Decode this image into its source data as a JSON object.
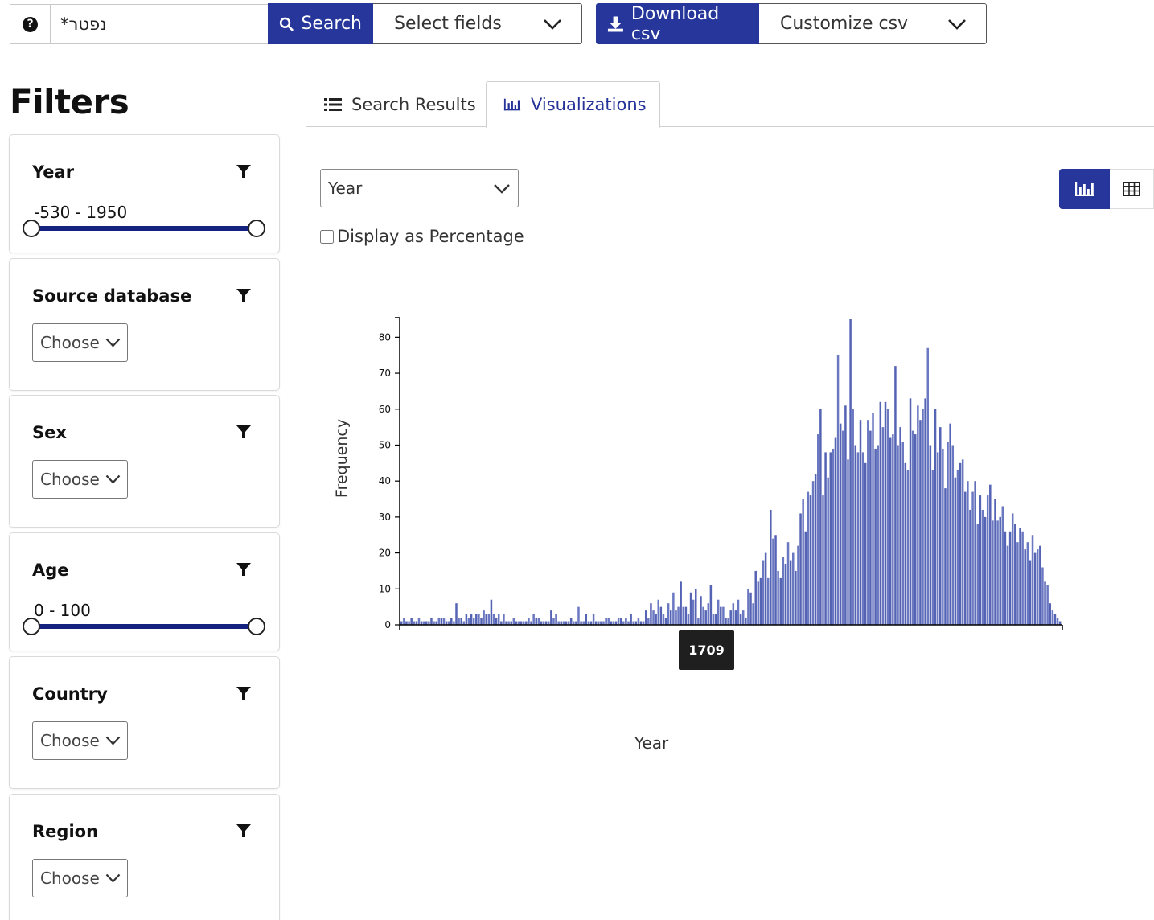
{
  "topbar": {
    "search_value": "נפטר*",
    "search_label": "Search",
    "select_fields_label": "Select fields",
    "download_label": "Download csv",
    "customize_label": "Customize csv"
  },
  "filters": {
    "title": "Filters",
    "year": {
      "title": "Year",
      "range_text": "-530 - 1950"
    },
    "source_database": {
      "title": "Source database",
      "value": "Choose"
    },
    "sex": {
      "title": "Sex",
      "value": "Choose"
    },
    "age": {
      "title": "Age",
      "range_text": "0 - 100"
    },
    "country": {
      "title": "Country",
      "value": "Choose"
    },
    "region": {
      "title": "Region",
      "value": "Choose"
    }
  },
  "tabs": [
    {
      "label": "Search Results",
      "icon": "list-icon",
      "active": false
    },
    {
      "label": "Visualizations",
      "icon": "bar-chart-icon",
      "active": true
    }
  ],
  "controls": {
    "variable_select": "Year",
    "percentage_label": "Display as Percentage",
    "percentage_checked": false,
    "active_view": "chart"
  },
  "tooltip": {
    "text": "1709"
  },
  "colors": {
    "primary": "#27369a",
    "bar": "#5563b4",
    "range_track": "#14237f"
  },
  "chart_data": {
    "type": "bar",
    "xlabel": "Year",
    "ylabel": "Frequency",
    "yticks": [
      0,
      10,
      20,
      30,
      40,
      50,
      60,
      70,
      80
    ],
    "ylim": [
      0,
      85
    ],
    "xlim": [
      -530,
      1950
    ],
    "x_tick_labels": [],
    "n_bins": 245,
    "values": [
      1,
      2,
      1,
      1,
      2,
      1,
      1,
      2,
      1,
      1,
      1,
      1,
      2,
      1,
      1,
      2,
      2,
      2,
      1,
      1,
      2,
      1,
      6,
      2,
      2,
      1,
      3,
      2,
      3,
      2,
      3,
      3,
      2,
      4,
      3,
      3,
      7,
      3,
      2,
      3,
      1,
      3,
      1,
      1,
      1,
      2,
      1,
      1,
      1,
      1,
      1,
      2,
      1,
      3,
      2,
      2,
      1,
      1,
      1,
      1,
      4,
      2,
      3,
      1,
      1,
      1,
      1,
      1,
      2,
      1,
      1,
      5,
      1,
      1,
      3,
      1,
      1,
      3,
      1,
      1,
      1,
      1,
      2,
      2,
      1,
      1,
      1,
      2,
      2,
      1,
      2,
      1,
      3,
      1,
      1,
      2,
      1,
      1,
      4,
      2,
      6,
      4,
      3,
      7,
      5,
      3,
      2,
      6,
      4,
      9,
      4,
      5,
      12,
      5,
      5,
      3,
      9,
      7,
      10,
      2,
      8,
      5,
      4,
      6,
      11,
      3,
      3,
      7,
      5,
      5,
      2,
      2,
      4,
      6,
      4,
      7,
      3,
      4,
      2,
      10,
      9,
      6,
      15,
      12,
      13,
      18,
      20,
      13,
      32,
      24,
      25,
      15,
      13,
      19,
      17,
      23,
      18,
      20,
      15,
      22,
      31,
      35,
      26,
      37,
      36,
      40,
      42,
      53,
      60,
      36,
      48,
      41,
      48,
      49,
      52,
      75,
      56,
      54,
      61,
      46,
      85,
      60,
      50,
      48,
      57,
      48,
      45,
      57,
      54,
      59,
      49,
      50,
      62,
      55,
      62,
      60,
      52,
      53,
      72,
      50,
      55,
      51,
      45,
      43,
      63,
      54,
      53,
      61,
      57,
      60,
      63,
      77,
      50,
      43,
      60,
      48,
      55,
      49,
      38,
      51,
      56,
      50,
      41,
      43,
      45,
      46,
      37,
      40,
      32,
      37,
      40,
      28,
      36,
      32,
      30,
      36,
      39,
      29,
      35,
      29,
      30,
      33,
      26,
      22,
      26,
      31,
      28,
      23,
      27,
      26,
      21,
      23,
      18,
      25,
      20,
      21,
      22,
      16,
      12,
      11,
      6,
      4,
      3,
      2,
      1
    ]
  }
}
